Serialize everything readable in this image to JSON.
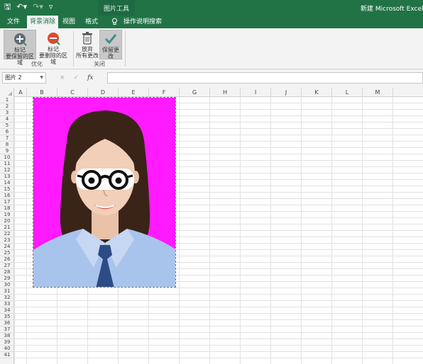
{
  "titlebar": {
    "context_tab_group": "图片工具",
    "document_title": "新建 Microsoft Excel 工作"
  },
  "quick_access": {
    "save_icon": "save-icon",
    "undo_icon": "undo-icon",
    "redo_icon": "redo-icon",
    "customize_icon": "customize-icon"
  },
  "tabs": [
    {
      "label": "文件"
    },
    {
      "label": "背景消除"
    },
    {
      "label": "视图"
    },
    {
      "label": "格式"
    }
  ],
  "tell_me": "操作说明搜索",
  "ribbon": {
    "mark_keep": "标记\n要保留的区域",
    "mark_keep_l1": "标记",
    "mark_keep_l2": "要保留的区域",
    "mark_remove_l1": "标记",
    "mark_remove_l2": "要删除的区域",
    "discard_l1": "放弃",
    "discard_l2": "所有更改",
    "keep_l1": "保留更改",
    "group_optimize": "优化",
    "group_close": "关闭"
  },
  "formula": {
    "name_box": "图片 2",
    "cancel": "×",
    "enter": "✓",
    "fx": "fx",
    "value": ""
  },
  "columns": [
    "A",
    "B",
    "C",
    "D",
    "E",
    "F",
    "G",
    "H",
    "I",
    "J",
    "K",
    "L",
    "M"
  ],
  "rows": [
    "1",
    "2",
    "3",
    "4",
    "5",
    "6",
    "7",
    "8",
    "9",
    "10",
    "11",
    "12",
    "13",
    "14",
    "15",
    "16",
    "17",
    "18",
    "19",
    "20",
    "21",
    "22",
    "23",
    "24",
    "25",
    "26",
    "27",
    "28",
    "29",
    "30",
    "31",
    "32",
    "33",
    "34",
    "35",
    "36",
    "37",
    "38",
    "39",
    "40",
    "41"
  ],
  "colors": {
    "excel_green": "#217346",
    "photo_background": "#ff1aff",
    "shirt": "#a9c4ec",
    "tie": "#2d4b84"
  }
}
